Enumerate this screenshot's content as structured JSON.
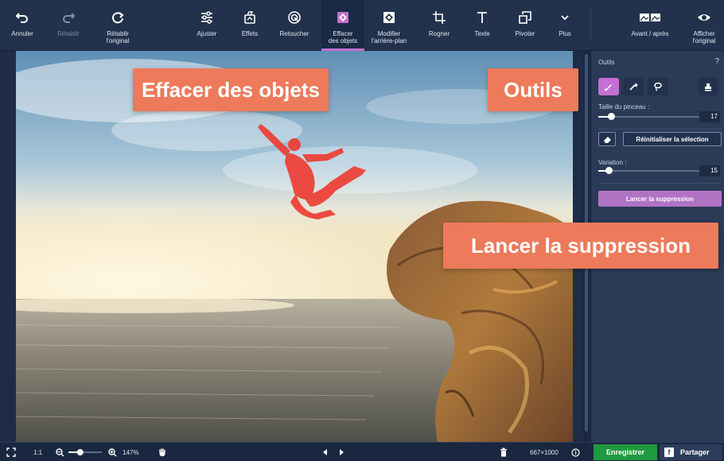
{
  "toolbar": {
    "undo": "Annuler",
    "redo": "Rétablir",
    "restore": "Rétablir\nl'original",
    "adjust": "Ajuster",
    "effects": "Effets",
    "retouch": "Retoucher",
    "erase": "Effacer\ndes objets",
    "background": "Modifier\nl'arrière-plan",
    "crop": "Rogner",
    "text": "Texte",
    "rotate": "Pivoter",
    "more": "Plus",
    "before_after": "Avant / après",
    "show_original": "Afficher\nl'original"
  },
  "panel": {
    "title": "Outils",
    "help": "?",
    "brush_size_label": "Taille du pinceau :",
    "brush_size_value": "17",
    "brush_size_fraction": 0.12,
    "reset_selection": "Réinitialiser la sélection",
    "variation_label": "Variation :",
    "variation_value": "15",
    "variation_fraction": 0.1,
    "run_removal": "Lancer la suppression"
  },
  "statusbar": {
    "fit": "1:1",
    "zoom": "147%",
    "dimensions": "667×1000",
    "save": "Enregistrer",
    "share": "Partager",
    "share_badge": "f",
    "zoom_fraction": 0.35
  },
  "callouts": {
    "erase_objects": "Effacer des objets",
    "tools": "Outils",
    "run_removal": "Lancer la suppression"
  },
  "colors": {
    "accent": "#c46fd3",
    "callout": "#ec7a5b",
    "save": "#1f9a3f",
    "toolbar_bg": "#22324d",
    "panel_bg": "#2a3a57"
  }
}
